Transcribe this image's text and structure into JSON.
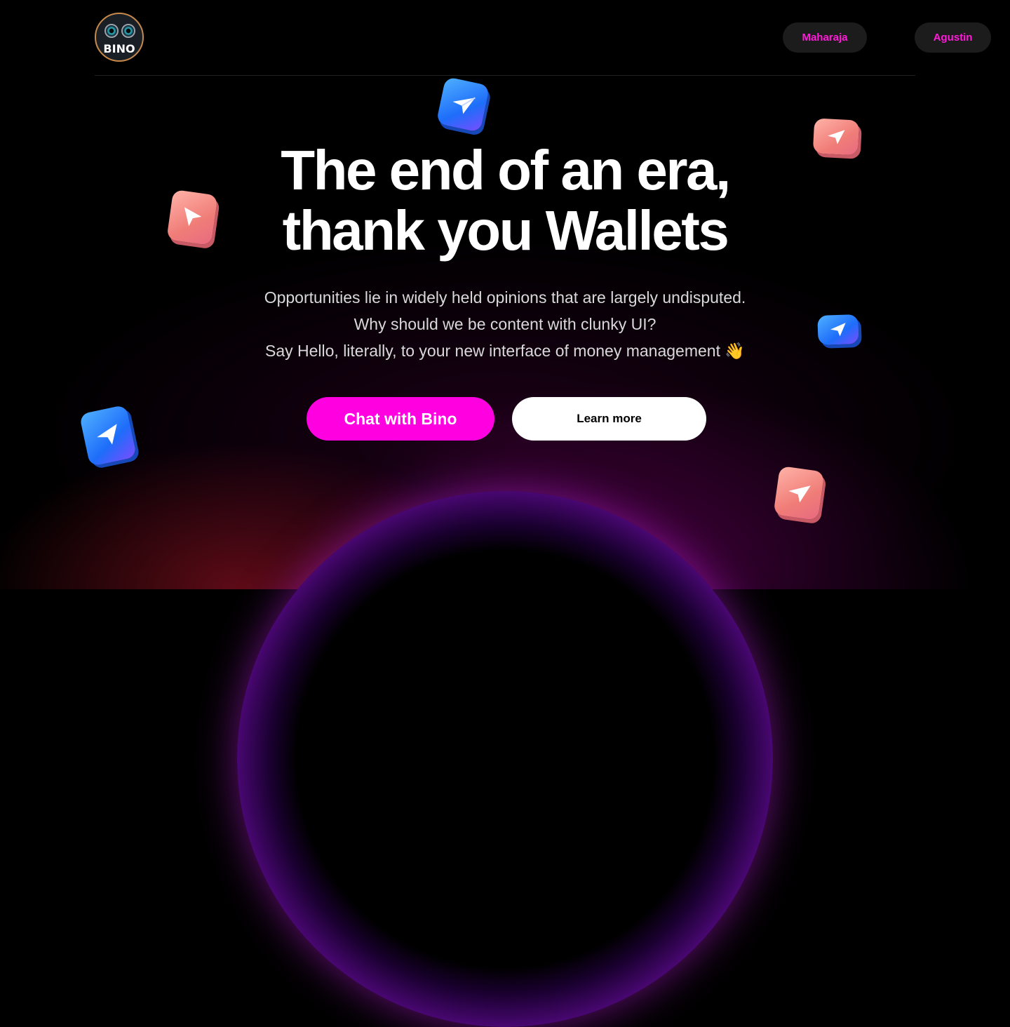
{
  "header": {
    "logo_text": "BINO",
    "nav": [
      {
        "label": "Maharaja"
      },
      {
        "label": "Agustin"
      }
    ]
  },
  "hero": {
    "title_line1": "The end of an era,",
    "title_line2": "thank you Wallets",
    "subtitle_lines": [
      "Opportunities lie in widely held opinions that are largely undisputed.",
      "Why should we be content with clunky UI?",
      "Say Hello, literally, to your new interface of money management 👋"
    ]
  },
  "actions": {
    "primary_label": "Chat with Bino",
    "secondary_label": "Learn more"
  },
  "decor": {
    "tile_icon": "paper-plane-icon",
    "colors": {
      "accent": "#ff00e1",
      "blue_tile": "#1e6dfa",
      "pink_tile": "#f07d78"
    }
  }
}
